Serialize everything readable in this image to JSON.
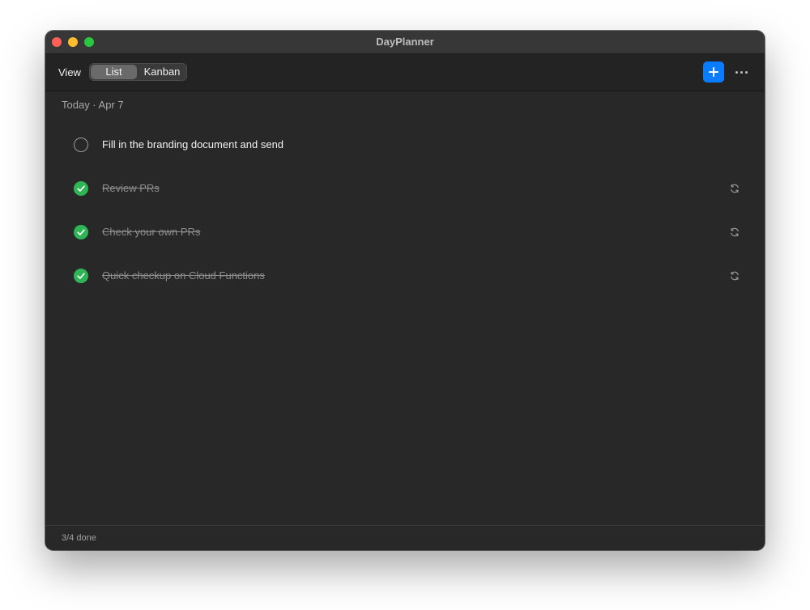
{
  "window": {
    "title": "DayPlanner"
  },
  "toolbar": {
    "view_label": "View",
    "segments": [
      {
        "label": "List",
        "selected": true
      },
      {
        "label": "Kanban",
        "selected": false
      }
    ],
    "add_icon": "plus-icon",
    "more_icon": "ellipsis-icon",
    "accent_color": "#0a7cff"
  },
  "section": {
    "header": "Today · Apr 7"
  },
  "tasks": [
    {
      "title": "Fill in the branding document and send",
      "done": false,
      "repeating": false
    },
    {
      "title": "Review PRs",
      "done": true,
      "repeating": true
    },
    {
      "title": "Check your own PRs",
      "done": true,
      "repeating": true
    },
    {
      "title": "Quick checkup on Cloud Functions",
      "done": true,
      "repeating": true
    }
  ],
  "colors": {
    "done_check": "#2fb456"
  },
  "status": {
    "summary": "3/4 done"
  }
}
